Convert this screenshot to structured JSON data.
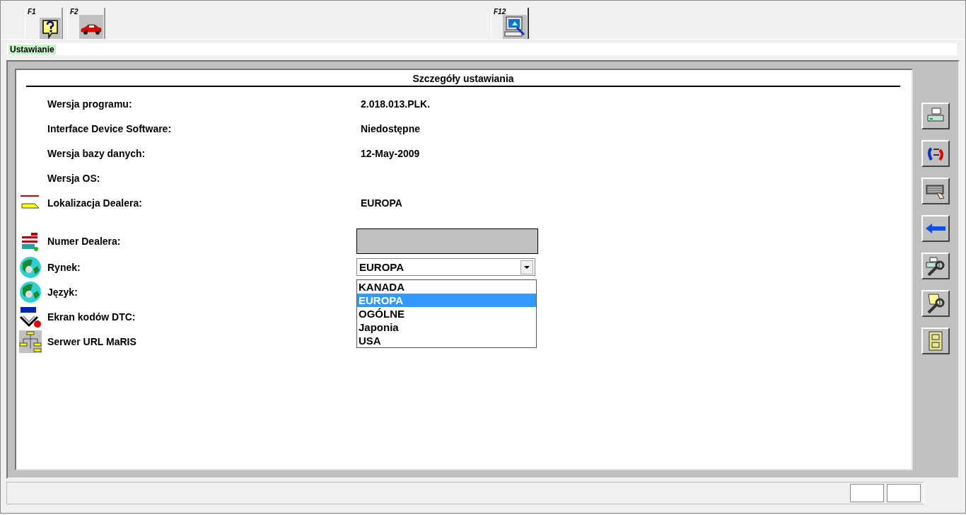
{
  "toolbar": {
    "keys": [
      {
        "label": "F1"
      },
      {
        "label": "F2"
      },
      {
        "label": "F12"
      }
    ]
  },
  "breadcrumb": {
    "label": "Ustawianie"
  },
  "panel": {
    "title": "Szczegóły ustawiania",
    "rows": [
      {
        "kind": "text",
        "label": "Wersja programu:",
        "value": "2.018.013.PLK."
      },
      {
        "kind": "text",
        "label": "Interface Device Software:",
        "value": "Niedostępne"
      },
      {
        "kind": "text",
        "label": "Wersja bazy danych:",
        "value": "12-May-2009"
      },
      {
        "kind": "text",
        "label": "Wersja OS:"
      },
      {
        "kind": "text",
        "label": "Lokalizacja Dealera:",
        "value": "EUROPA"
      },
      {
        "kind": "field",
        "label": "Numer Dealera:"
      },
      {
        "kind": "combo",
        "label": "Rynek:",
        "value": "EUROPA",
        "expanded": true,
        "options": [
          {
            "label": "KANADA",
            "selected": false
          },
          {
            "label": "EUROPA",
            "selected": true
          },
          {
            "label": "OGÓLNE",
            "selected": false
          },
          {
            "label": "Japonia",
            "selected": false
          },
          {
            "label": "USA",
            "selected": false
          }
        ]
      },
      {
        "kind": "hidden",
        "label": "Język:"
      },
      {
        "kind": "hidden",
        "label": "Ekran kodów DTC:"
      },
      {
        "kind": "hidden",
        "label": "Serwer URL MaRIS"
      }
    ]
  }
}
